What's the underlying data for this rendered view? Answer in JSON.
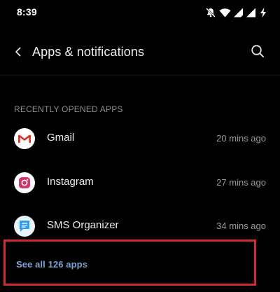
{
  "status_bar": {
    "time": "8:39",
    "icons": [
      "mute-bell-icon",
      "wifi-icon",
      "signal-icon",
      "signal-icon",
      "battery-charging-icon"
    ]
  },
  "app_bar": {
    "title": "Apps & notifications",
    "back_icon": "chevron-left-icon",
    "search_icon": "search-icon"
  },
  "section": {
    "header": "RECENTLY OPENED APPS"
  },
  "apps": [
    {
      "name": "Gmail",
      "time": "20 mins ago",
      "icon": "gmail-icon"
    },
    {
      "name": "Instagram",
      "time": "27 mins ago",
      "icon": "instagram-icon"
    },
    {
      "name": "SMS Organizer",
      "time": "34 mins ago",
      "icon": "sms-organizer-icon"
    }
  ],
  "see_all": {
    "label": "See all 126 apps"
  },
  "colors": {
    "background": "#000000",
    "link": "#7fa2d4",
    "highlight_box": "#d02a31",
    "gmail_red": "#d93025",
    "instagram_pink": "#d6336c",
    "sms_blue": "#2a9df4"
  }
}
